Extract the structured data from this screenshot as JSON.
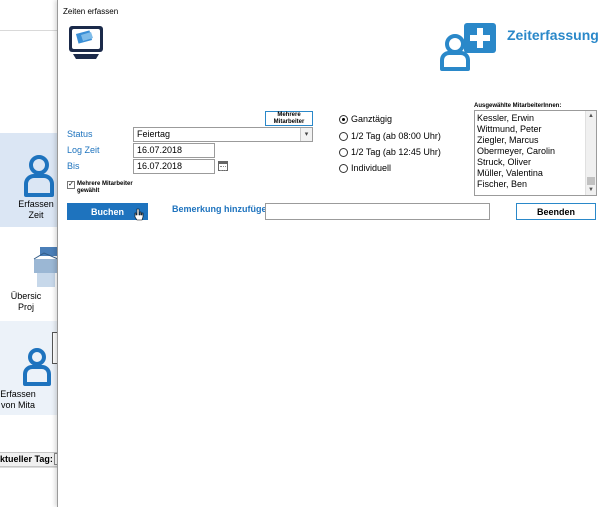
{
  "background": {
    "nav_items": [
      {
        "label": "Erfassen\nZeit"
      },
      {
        "label": "Übersic\nProj"
      },
      {
        "label": "Erfassen\nvon Mita"
      }
    ],
    "status_label": "ktueller Tag:"
  },
  "dialog": {
    "title": "Zeiten erfassen",
    "brand_title": "Zeiterfassung",
    "accent_color": "#1e73be"
  },
  "form": {
    "mehrere_button_label": "Mehrere\nMitarbeiter",
    "status": {
      "label": "Status",
      "value": "Feiertag"
    },
    "log_zeit": {
      "label": "Log Zeit",
      "value": "16.07.2018"
    },
    "bis": {
      "label": "Bis",
      "value": "16.07.2018"
    },
    "mehrere_checkbox": {
      "label": "Mehrere Mitarbeiter\ngewählt",
      "checked": true
    }
  },
  "day_options": [
    {
      "label": "Ganztägig",
      "checked": true
    },
    {
      "label": "1/2 Tag (ab 08:00 Uhr)",
      "checked": false
    },
    {
      "label": "1/2 Tag (ab 12:45 Uhr)",
      "checked": false
    },
    {
      "label": "Individuell",
      "checked": false
    }
  ],
  "employees": {
    "title": "Ausgewählte MitarbeiterInnen:",
    "items": [
      "Kessler, Erwin",
      "Wittmund, Peter",
      "Ziegler, Marcus",
      "Obermeyer, Carolin",
      "Struck, Oliver",
      "Müller, Valentina",
      "Fischer, Ben"
    ]
  },
  "actions": {
    "buchen_label": "Buchen",
    "bemerkung_label": "Bemerkung hinzufügen:",
    "bemerkung_value": "",
    "beenden_label": "Beenden"
  }
}
